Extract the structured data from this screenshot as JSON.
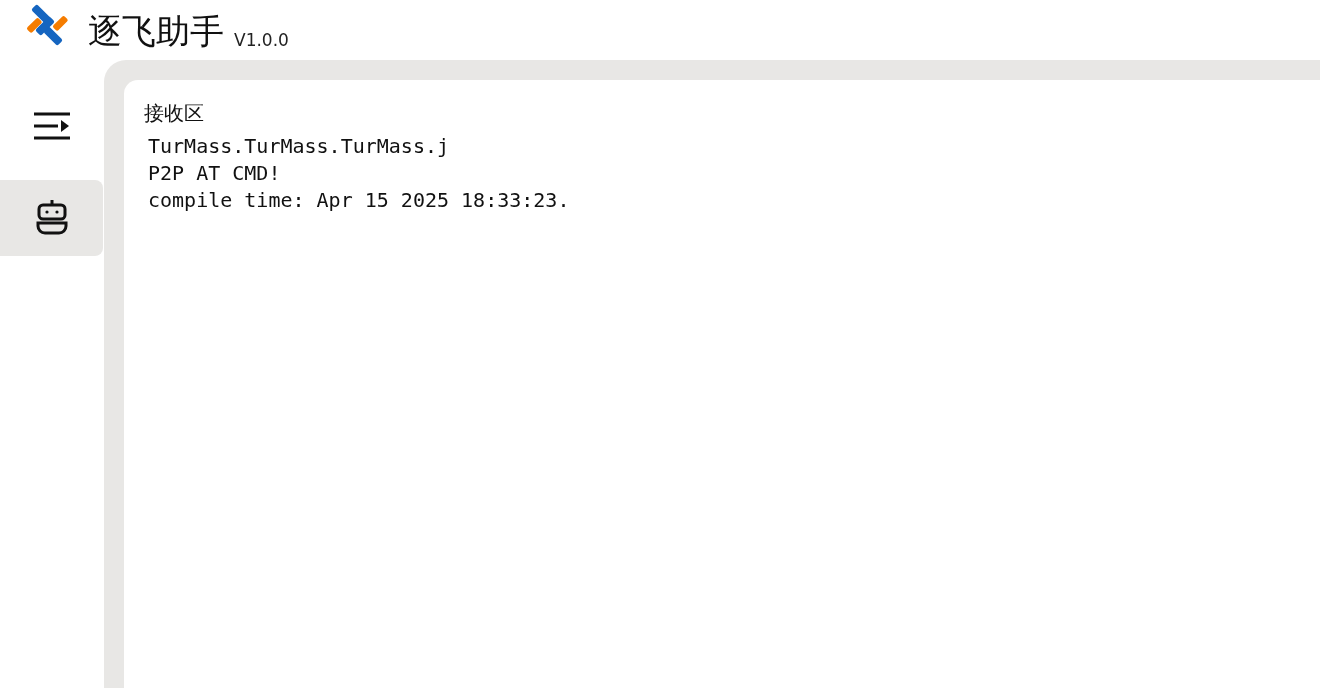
{
  "app": {
    "title": "逐飞助手",
    "version": "V1.0.0"
  },
  "sidebar": {
    "nav_items": [
      {
        "kind": "robot",
        "selected": true
      }
    ]
  },
  "receive_area": {
    "title": "接收区",
    "lines": [
      "TurMass.TurMass.TurMass.j",
      "P2P AT CMD!",
      "compile time: Apr 15 2025 18:33:23."
    ]
  }
}
